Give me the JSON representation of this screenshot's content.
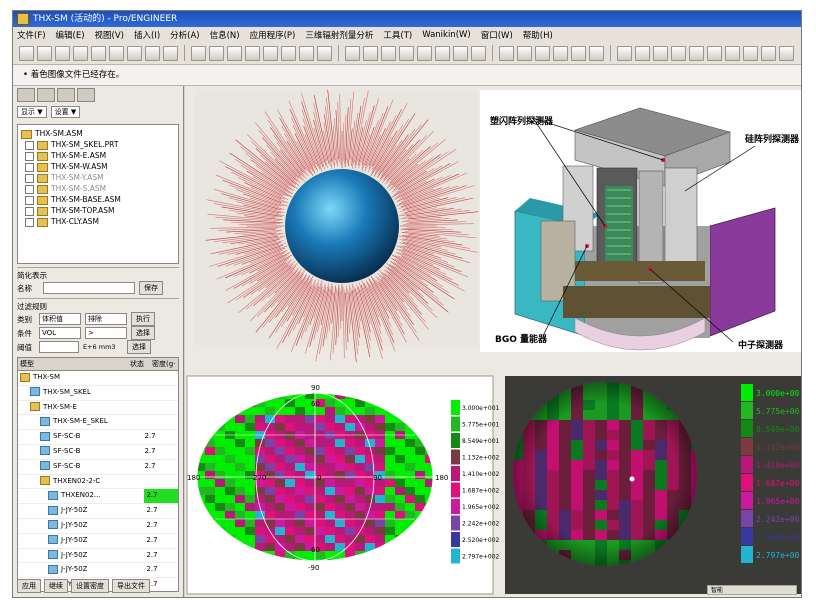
{
  "window": {
    "title": "THX-SM (活动的) - Pro/ENGINEER"
  },
  "menu": [
    "文件(F)",
    "编辑(E)",
    "视图(V)",
    "插入(I)",
    "分析(A)",
    "信息(N)",
    "应用程序(P)",
    "三维辐射剂量分析",
    "工具(T)",
    "Wanikin(W)",
    "窗口(W)",
    "帮助(H)"
  ],
  "message": "• 着色图像文件已经存在。",
  "left": {
    "show_dropdown": "显示 ▼",
    "settings_dropdown": "设置 ▼",
    "tree": [
      {
        "label": "THX-SM.ASM",
        "dim": false,
        "root": true
      },
      {
        "label": "THX-SM_SKEL.PRT",
        "dim": false
      },
      {
        "label": "THX-SM-E.ASM",
        "dim": false
      },
      {
        "label": "THX-SM-W.ASM",
        "dim": false
      },
      {
        "label": "THX-SM-Y.ASM",
        "dim": true
      },
      {
        "label": "THX-SM-S.ASM",
        "dim": true
      },
      {
        "label": "THX-SM-BASE.ASM",
        "dim": false
      },
      {
        "label": "THX-SM-TOP.ASM",
        "dim": false
      },
      {
        "label": "THX-CLY.ASM",
        "dim": false
      }
    ],
    "simplified_rep": "简化表示",
    "name_label": "名称",
    "save_btn": "保存",
    "filter_rule": "过滤规则",
    "type_label": "类别",
    "type_value": "体积值",
    "op_value": "排除",
    "exec_btn": "执行",
    "cond_label": "条件",
    "cond_value": "VOL",
    "cmp_value": ">",
    "select_btn": "选择",
    "threshold_label": "阈值",
    "threshold_unit": "E+6 mm3",
    "select_btn2": "选择",
    "grid_headers": [
      "模型",
      "状态",
      "密度(g·"
    ],
    "grid_rows": [
      {
        "label": "THX-SM",
        "val": "",
        "y": true
      },
      {
        "label": "THX-SM_SKEL",
        "val": "",
        "y": false
      },
      {
        "label": "THX-SM-E",
        "val": "",
        "y": true
      },
      {
        "label": "THX-SM-E_SKEL",
        "val": "",
        "y": false
      },
      {
        "label": "SF-SC-B",
        "val": "2.7",
        "y": false
      },
      {
        "label": "SF-SC-B",
        "val": "2.7",
        "y": false
      },
      {
        "label": "SF-SC-B",
        "val": "2.7",
        "y": false
      },
      {
        "label": "THXEN02-2-C",
        "val": "",
        "y": true
      },
      {
        "label": "THXEN02...",
        "val": "2.7",
        "y": false,
        "hl": true
      },
      {
        "label": "J-JY-50Z",
        "val": "2.7",
        "y": false
      },
      {
        "label": "J-JY-50Z",
        "val": "2.7",
        "y": false
      },
      {
        "label": "J-JY-50Z",
        "val": "2.7",
        "y": false
      },
      {
        "label": "J-JY-50Z",
        "val": "2.7",
        "y": false
      },
      {
        "label": "J-JY-50Z",
        "val": "2.7",
        "y": false
      },
      {
        "label": "J-JY-50Z",
        "val": "2.7",
        "y": false
      }
    ],
    "bottom_buttons": [
      "应用",
      "继续",
      "设置密度",
      "导出文件"
    ]
  },
  "detector": {
    "labels": {
      "plastic": "塑闪阵列探测器",
      "silicon": "硅阵列探测器",
      "bgo": "BGO 量能器",
      "neutron": "中子探测器"
    }
  },
  "map": {
    "lat_top": "90",
    "lat_bottom": "-90",
    "lat_n60": "60",
    "lat_s60": "60",
    "lon_left": "180",
    "lon_right": "180",
    "lon_ticks": [
      "270",
      "0",
      "90"
    ],
    "legend": [
      "3.000e+001",
      "5.775e+001",
      "8.549e+001",
      "1.132e+002",
      "1.410e+002",
      "1.687e+002",
      "1.965e+002",
      "2.242e+002",
      "2.520e+002",
      "2.797e+002"
    ],
    "legend_colors": [
      "#00ee00",
      "#22b822",
      "#148a14",
      "#7a3a40",
      "#b81878",
      "#e0107a",
      "#cc1aa0",
      "#7844a8",
      "#3838a0",
      "#22b4d0"
    ]
  },
  "sphere_legend": [
    "3.000e+00",
    "5.775e+00",
    "8.549e+00",
    "1.132e+00",
    "1.410e+00",
    "1.687e+00",
    "1.965e+00",
    "2.242e+00",
    "2.520e+00",
    "2.797e+00"
  ],
  "status": "智能"
}
